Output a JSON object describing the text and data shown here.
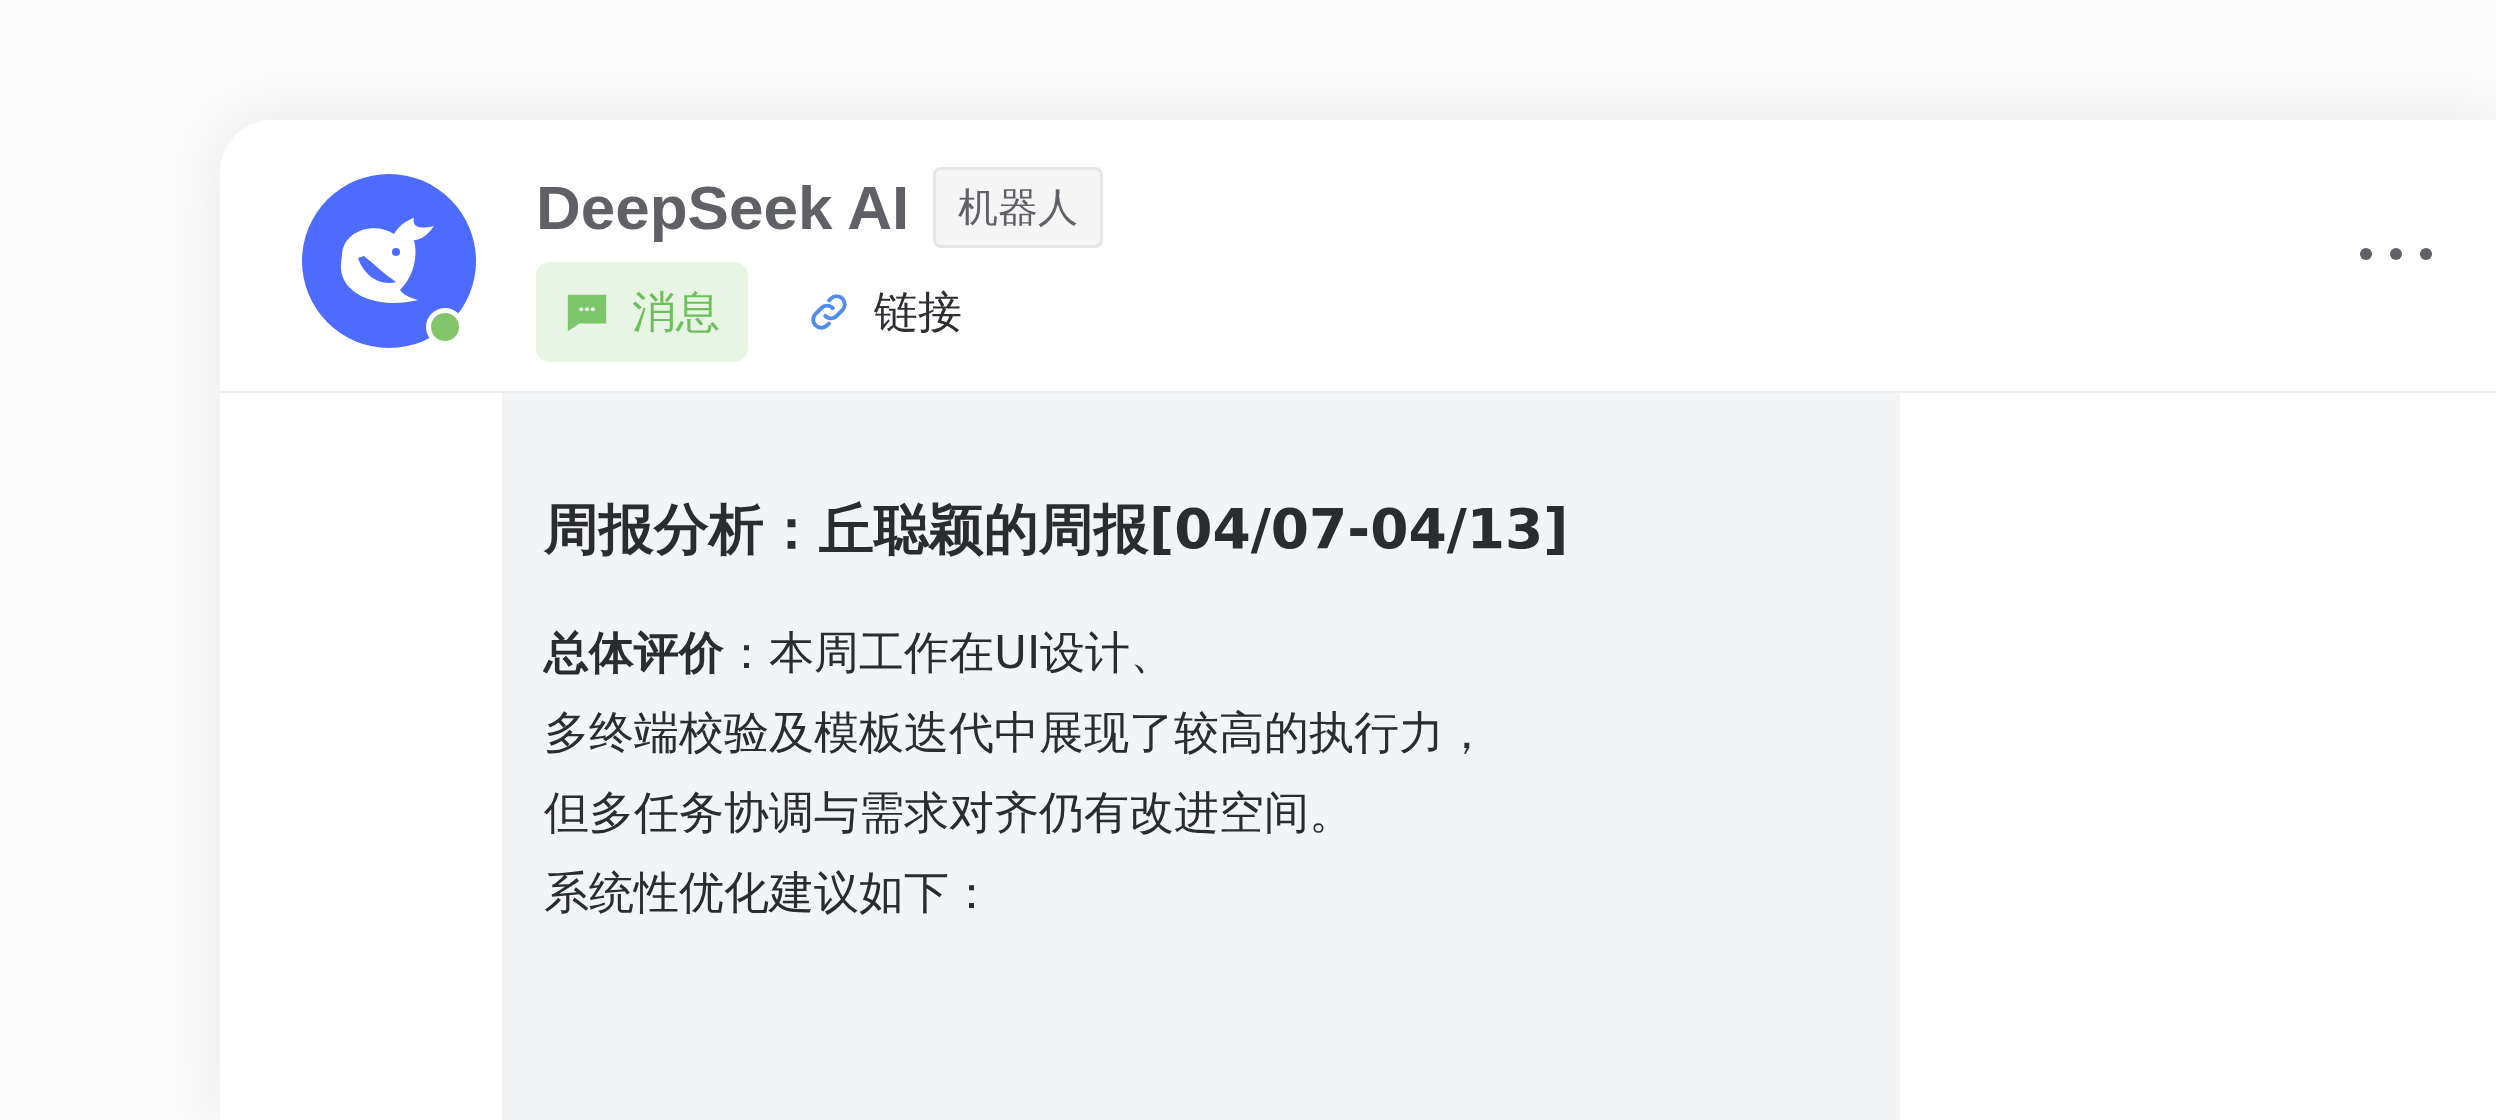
{
  "header": {
    "name": "DeepSeek AI",
    "badge": "机器人",
    "online": true
  },
  "tabs": [
    {
      "kind": "message",
      "label": "消息",
      "selected": true
    },
    {
      "kind": "link",
      "label": "链接",
      "selected": false
    }
  ],
  "message": {
    "title": "周报分析：丘聪颖的周报[04/07-04/13]",
    "lines": [
      "**总体评价**：本周工作在UI设计、",
      "多终端校验及模板迭代中展现了较高的执行力，",
      "但多任务协调与需求对齐仍有改进空间。",
      "系统性优化建议如下："
    ]
  }
}
